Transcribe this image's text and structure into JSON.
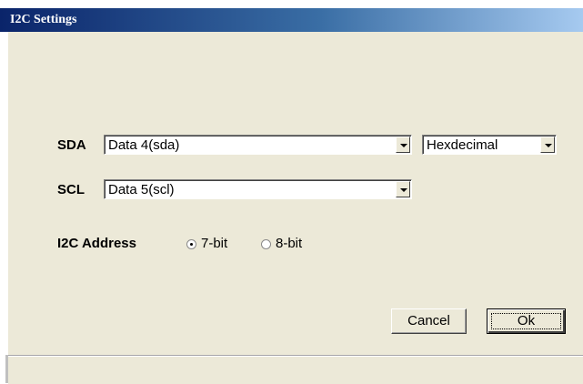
{
  "window": {
    "title": "I2C Settings"
  },
  "sda": {
    "label": "SDA",
    "selected": "Data 4(sda)"
  },
  "format": {
    "selected": "Hexdecimal"
  },
  "scl": {
    "label": "SCL",
    "selected": "Data 5(scl)"
  },
  "address": {
    "label": "I2C Address",
    "options": [
      {
        "label": "7-bit",
        "checked": true
      },
      {
        "label": "8-bit",
        "checked": false
      }
    ]
  },
  "buttons": {
    "cancel": "Cancel",
    "ok": "Ok"
  },
  "colors": {
    "title_bar": "#0a246a",
    "dialog_face": "#ece9d8"
  },
  "icons": {
    "dropdown": "chevron-down-icon"
  }
}
